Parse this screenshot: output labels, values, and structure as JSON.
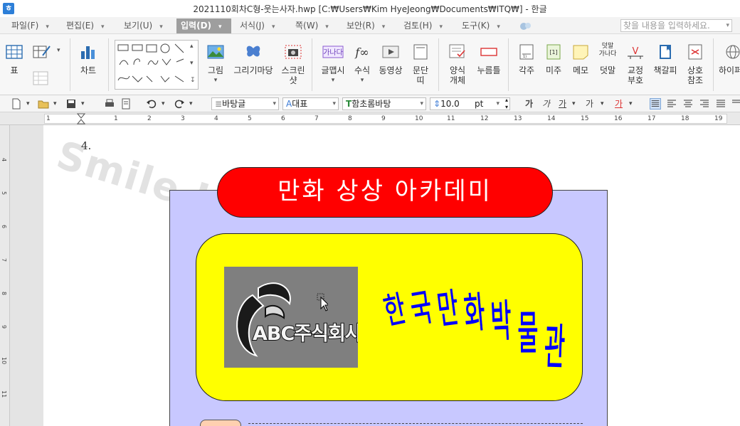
{
  "window": {
    "title": "2021110회차C형-웃는사자.hwp [C:₩Users₩Kim HyeJeong₩Documents₩ITQ₩] - 한글",
    "app_icon_glyph": "ㅎ"
  },
  "menu": {
    "items": [
      {
        "label": "파일(F)",
        "has_dropdown": true
      },
      {
        "label": "편집(E)",
        "has_dropdown": true
      },
      {
        "label": "보기(U)",
        "has_dropdown": true
      },
      {
        "label": "입력(D)",
        "has_dropdown": true,
        "active": true
      },
      {
        "label": "서식(J)",
        "has_dropdown": true
      },
      {
        "label": "쪽(W)",
        "has_dropdown": true
      },
      {
        "label": "보안(R)",
        "has_dropdown": true
      },
      {
        "label": "검토(H)",
        "has_dropdown": true
      },
      {
        "label": "도구(K)",
        "has_dropdown": true
      }
    ],
    "search_placeholder": "찾을 내용을 입력하세요."
  },
  "ribbon": {
    "table_label": "표",
    "chart_label": "차트",
    "picture_label": "그림",
    "drawing_label": "그리기마당",
    "screenshot_label": "스크린\n샷",
    "wordart_label": "글맵시",
    "formula_label": "수식",
    "video_label": "동영상",
    "paragraph_label": "문단\n띠",
    "form_label": "양식\n개체",
    "pushbutton_label": "누름틀",
    "footnote_label": "각주",
    "endnote_label": "미주",
    "memo_label": "메모",
    "overlap_label": "덧말",
    "overlap_icon_text": "덧말\n가나다",
    "proofread_label": "교정\n부호",
    "bookmark_label": "책갈피",
    "crossref_label": "상호\n참조",
    "hyperlink_label": "하이퍼"
  },
  "format_toolbar": {
    "style": "바탕글",
    "lang": "대표",
    "font": "함초롬바탕",
    "font_size": "10.0",
    "size_unit": "pt",
    "text_styles": [
      "가",
      "가",
      "가",
      "가",
      "가"
    ]
  },
  "ruler": {
    "h_numbers": [
      "1",
      "1",
      "2",
      "3",
      "4",
      "5",
      "6",
      "7",
      "8",
      "9",
      "10",
      "11",
      "12",
      "13",
      "14",
      "15",
      "16",
      "17",
      "18",
      "19"
    ],
    "v_numbers": [
      "4",
      "5",
      "6",
      "7",
      "8",
      "9",
      "10",
      "11"
    ]
  },
  "document": {
    "watermark": "Smile Li",
    "question_number": "4.",
    "banner_title": "만화 상상 아카데미",
    "logo_text": "ABC주식회사",
    "wordart_text": "한국만화박물관",
    "wordart_color": "#0000ff",
    "banner_color": "#ff0000",
    "frame_color": "#c8c8ff",
    "inner_box_color": "#ffff00"
  }
}
